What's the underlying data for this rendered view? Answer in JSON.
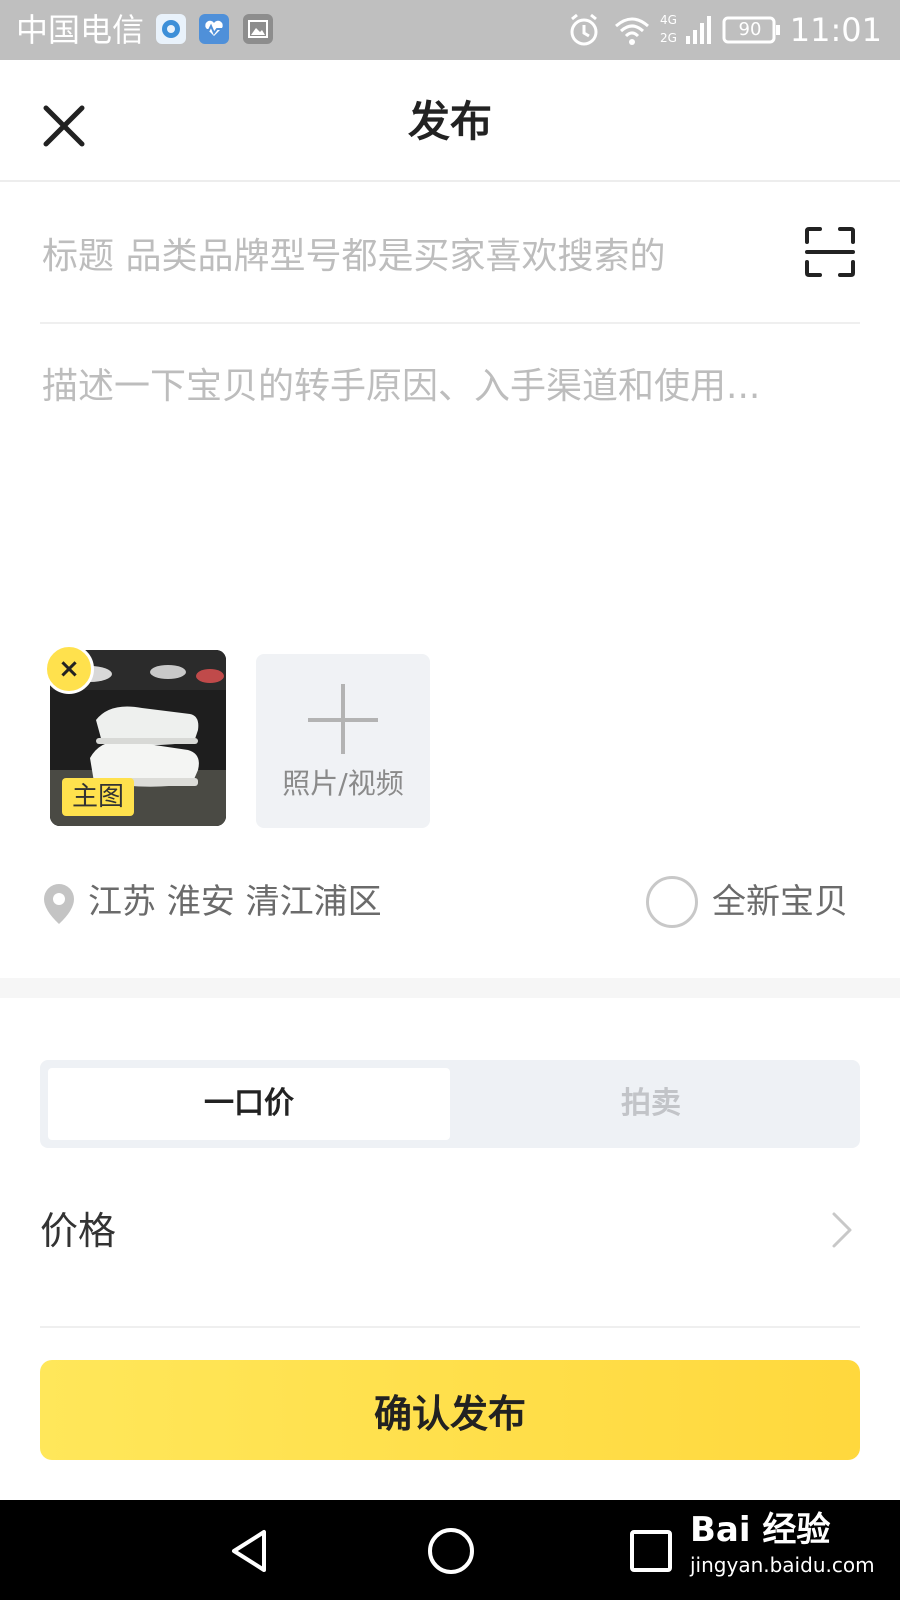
{
  "status_bar": {
    "carrier": "中国电信",
    "battery": "90",
    "network": "4G 2G",
    "time": "11:01"
  },
  "header": {
    "title": "发布",
    "close_icon": "close-icon"
  },
  "title_field": {
    "placeholder": "标题 品类品牌型号都是买家喜欢搜索的",
    "value": "",
    "scan_icon": "scan-icon"
  },
  "description_field": {
    "placeholder": "描述一下宝贝的转手原因、入手渠道和使用...",
    "value": ""
  },
  "media": {
    "thumb_badge": "主图",
    "remove_symbol": "×",
    "add_label": "照片/视频"
  },
  "location": {
    "text": "江苏 淮安 清江浦区",
    "icon": "location-pin-icon"
  },
  "new_item": {
    "label": "全新宝贝",
    "checked": false
  },
  "price_mode": {
    "tabs": [
      "一口价",
      "拍卖"
    ],
    "active": "一口价"
  },
  "price": {
    "label": "价格"
  },
  "publish_button": {
    "label": "确认发布"
  },
  "watermark": {
    "main": "Bai 经验",
    "sub": "jingyan.baidu.com"
  },
  "colors": {
    "accent": "#ffde4d",
    "status_bar_bg": "#bfbfbf",
    "placeholder": "#bdbdbd"
  }
}
